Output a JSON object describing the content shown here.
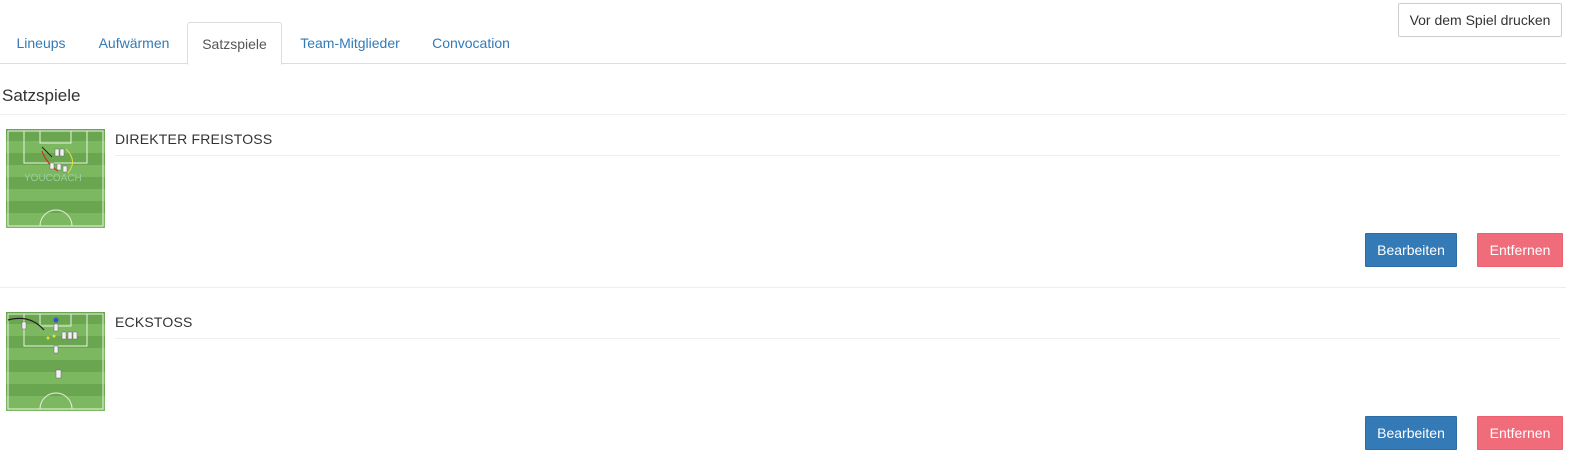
{
  "header": {
    "print_label": "Vor dem Spiel drucken"
  },
  "tabs": [
    {
      "label": "Lineups",
      "active": false
    },
    {
      "label": "Aufwärmen",
      "active": false
    },
    {
      "label": "Satzspiele",
      "active": true
    },
    {
      "label": "Team-Mitglieder",
      "active": false
    },
    {
      "label": "Convocation",
      "active": false
    }
  ],
  "section": {
    "title": "Satzspiele"
  },
  "items": [
    {
      "name": "DIREKTER FREISTOSS",
      "edit_label": "Bearbeiten",
      "remove_label": "Entfernen",
      "thumbnail_icon": "football-pitch-diagram",
      "watermark": "YOUCOACH"
    },
    {
      "name": "ECKSTOSS",
      "edit_label": "Bearbeiten",
      "remove_label": "Entfernen",
      "thumbnail_icon": "football-pitch-diagram"
    }
  ],
  "colors": {
    "link": "#337ab7",
    "primary": "#337ab7",
    "danger": "#f06c7a",
    "pitch_light": "#7cb860",
    "pitch_dark": "#6aa64f"
  }
}
